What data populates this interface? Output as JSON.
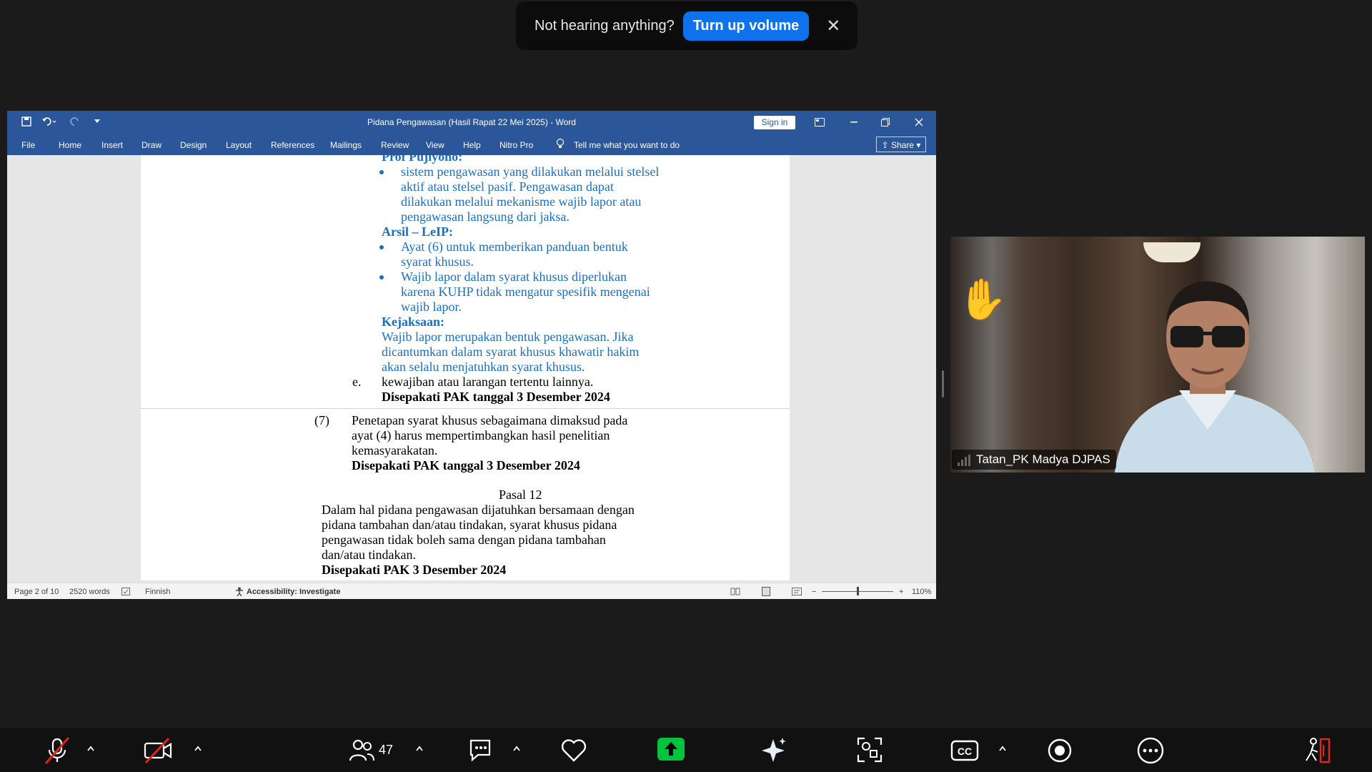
{
  "toast": {
    "message": "Not hearing anything?",
    "button": "Turn up volume",
    "close": "✕"
  },
  "word": {
    "title": "Pidana Pengawasan (Hasil Rapat 22 Mei 2025)  -  Word",
    "sign_in": "Sign in",
    "tabs": [
      "File",
      "Home",
      "Insert",
      "Draw",
      "Design",
      "Layout",
      "References",
      "Mailings",
      "Review",
      "View",
      "Help",
      "Nitro Pro"
    ],
    "tell_me": "Tell me what you want to do",
    "share": "Share",
    "document": {
      "l01": "Prof Pujiyono:",
      "l02": "sistem pengawasan yang dilakukan melalui stelsel",
      "l03": "aktif   atau   stelsel   pasif.   Pengawasan   dapat",
      "l04": "dilakukan  melalui  mekanisme  wajib  lapor  atau",
      "l05": "pengawasan langsung dari jaksa.",
      "l06": "Arsil – LeIP:",
      "l07": "Ayat   (6)   untuk   memberikan   panduan   bentuk",
      "l08": "syarat khusus.",
      "l09": "Wajib   lapor   dalam   syarat   khusus   diperlukan",
      "l10": "karena  KUHP  tidak  mengatur  spesifik  mengenai",
      "l11": "wajib lapor.",
      "l12": "Kejaksaan:",
      "l13": "Wajib  lapor  merupakan  bentuk  pengawasan.  Jika",
      "l14": "dicantumkan  dalam  syarat  khusus  khawatir  hakim",
      "l15": "akan selalu menjatuhkan syarat khusus.",
      "l16_num": "e.",
      "l16": "kewajiban atau larangan tertentu lainnya.",
      "l17": "Disepakati PAK tanggal 3 Desember 2024",
      "l18_num": "(7)",
      "l18": "Penetapan  syarat  khusus  sebagaimana  dimaksud  pada",
      "l19": "ayat   (4)   harus   mempertimbangkan   hasil   penelitian",
      "l20": "kemasyarakatan.",
      "l21": "Disepakati PAK tanggal 3 Desember 2024",
      "l22": "Pasal 12",
      "l23": "Dalam  hal  pidana  pengawasan  dijatuhkan  bersamaan  dengan",
      "l24": "pidana  tambahan  dan/atau  tindakan,  syarat  khusus  pidana",
      "l25": "pengawasan  tidak  boleh  sama  dengan  pidana  tambahan",
      "l26": "dan/atau tindakan.",
      "l27": "Disepakati PAK 3 Desember 2024"
    },
    "status": {
      "page": "Page 2 of 10",
      "words": "2520 words",
      "language": "Finnish",
      "accessibility": "Accessibility: Investigate",
      "zoom": "110%",
      "zoom_minus": "−",
      "zoom_plus": "+"
    }
  },
  "video": {
    "participant_name": "Tatan_PK Madya DJPAS",
    "hand": "✋"
  },
  "toolbar": {
    "participants_count": "47"
  },
  "colors": {
    "word_blue": "#2b579a",
    "doc_blue": "#1a6fc0",
    "zoom_blue": "#0e72ed",
    "share_green": "#00c43e"
  }
}
